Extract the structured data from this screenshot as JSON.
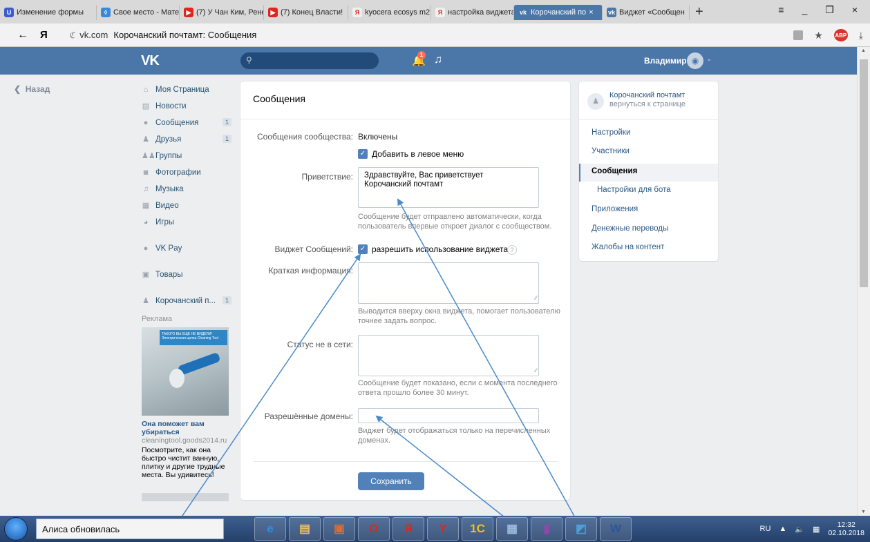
{
  "browser": {
    "tabs": [
      {
        "label": "Изменение формы",
        "icon_color": "#3b5ccc",
        "icon": "U"
      },
      {
        "label": "Свое место - Мате",
        "icon_color": "#3a88d8",
        "icon": "◊"
      },
      {
        "label": "(7) У Чан Ким, Рене",
        "icon_color": "#e0261c",
        "icon": "▶"
      },
      {
        "label": "(7) Конец Власти!",
        "icon_color": "#e0261c",
        "icon": "▶"
      },
      {
        "label": "kyocera ecosys m2",
        "icon_color": "#f0f0f0",
        "icon": "Я"
      },
      {
        "label": "настройка виджета",
        "icon_color": "#f0f0f0",
        "icon": "Я"
      },
      {
        "label": "Корочанский по",
        "icon_color": "#4a76a8",
        "icon": "vk"
      },
      {
        "label": "Виджет «Сообщен",
        "icon_color": "#4a76a8",
        "icon": "vk"
      }
    ],
    "active_tab_index": 6,
    "tab_close": "×",
    "new_tab": "+",
    "window_controls": [
      "≡",
      "_",
      "❐",
      "×"
    ],
    "back": "←",
    "ya_logo": "Я",
    "reload": "ℭ",
    "host": "vk.com",
    "page_title": "Корочанский почтамт: Сообщения",
    "star": "★",
    "ext_badge": "ABP",
    "download": "⤓"
  },
  "vk_header": {
    "logo": "VK",
    "notif_count": "1",
    "user_name": "Владимир"
  },
  "back_link": "Назад",
  "left_menu": {
    "items": [
      {
        "label": "Моя Страница",
        "icon": "⌂"
      },
      {
        "label": "Новости",
        "icon": "▤"
      },
      {
        "label": "Сообщения",
        "icon": "●",
        "count": "1"
      },
      {
        "label": "Друзья",
        "icon": "♟",
        "count": "1"
      },
      {
        "label": "Группы",
        "icon": "♟♟"
      },
      {
        "label": "Фотографии",
        "icon": "◙"
      },
      {
        "label": "Музыка",
        "icon": "♫"
      },
      {
        "label": "Видео",
        "icon": "▦"
      },
      {
        "label": "Игры",
        "icon": "◕"
      }
    ],
    "vkpay": "VK Pay",
    "goods": "Товары",
    "group_short": "Корочанский п...",
    "group_count": "1",
    "ads_label": "Реклама",
    "ad": {
      "banner_text": "ТАКОГО ВЫ ЕЩЕ НЕ ВИДЕЛИ! Электрическая щетка Cleaning Tool",
      "title": "Она поможет вам убираться",
      "domain": "cleaningtool.goods2014.ru",
      "text": "Посмотрите, как она быстро чистит ванную, плитку и другие трудные места. Вы удивитесь!"
    }
  },
  "card": {
    "title": "Сообщения",
    "community_messages_label": "Сообщения сообщества:",
    "community_messages_value": "Включены",
    "add_left_menu_label": "Добавить в левое меню",
    "greeting_label": "Приветствие:",
    "greeting_value": "Здравствуйте, Вас приветствует\nКорочанский почтамт",
    "greeting_hint": "Сообщение будет отправлено автоматически, когда пользователь впервые откроет диалог с сообществом.",
    "widget_label": "Виджет Сообщений:",
    "widget_checkbox_label": "разрешить использование виджета",
    "help_mark": "?",
    "short_info_label": "Краткая информация:",
    "short_info_hint": "Выводится вверху окна виджета, помогает пользователю точнее задать вопрос.",
    "offline_label": "Статус не в сети:",
    "offline_hint": "Сообщение будет показано, если с момента последнего ответа прошло более 30 минут.",
    "domains_label": "Разрешённые домены:",
    "domains_hint": "Виджет будет отображаться только на перечисленных доменах.",
    "save_button": "Сохранить"
  },
  "right_menu": {
    "group_name": "Корочанский почтамт",
    "back_to_page": "вернуться к странице",
    "items": [
      {
        "label": "Настройки"
      },
      {
        "label": "Участники"
      },
      {
        "label": "Сообщения",
        "active": true
      },
      {
        "label": "Настройки для бота",
        "sub": true
      },
      {
        "label": "Приложения"
      },
      {
        "label": "Денежные переводы"
      },
      {
        "label": "Жалобы на контент"
      }
    ]
  },
  "taskbar": {
    "alisa_text": "Алиса обновилась",
    "apps": [
      {
        "name": "ie",
        "glyph": "e",
        "color": "#2f8fe0"
      },
      {
        "name": "explorer",
        "glyph": "▤",
        "color": "#e8c064"
      },
      {
        "name": "media",
        "glyph": "▣",
        "color": "#e06a2a"
      },
      {
        "name": "opera",
        "glyph": "O",
        "color": "#e0261c"
      },
      {
        "name": "yandex",
        "glyph": "Я",
        "color": "#e0261c"
      },
      {
        "name": "yandex-browser",
        "glyph": "Y",
        "color": "#e0261c"
      },
      {
        "name": "1c",
        "glyph": "1С",
        "color": "#f2c21b"
      },
      {
        "name": "network",
        "glyph": "▦",
        "color": "#9bb8dd"
      },
      {
        "name": "winrar",
        "glyph": "▮",
        "color": "#8c4aa8"
      },
      {
        "name": "notepad",
        "glyph": "◩",
        "color": "#4aa0d8"
      },
      {
        "name": "word",
        "glyph": "W",
        "color": "#2b5797"
      }
    ],
    "lang": "RU",
    "time": "12:32",
    "date": "02.10.2018"
  },
  "colors": {
    "vk_blue": "#4a76a8",
    "button_blue": "#5181b8",
    "link": "#2a5885",
    "arrow": "#4a8bc9"
  }
}
